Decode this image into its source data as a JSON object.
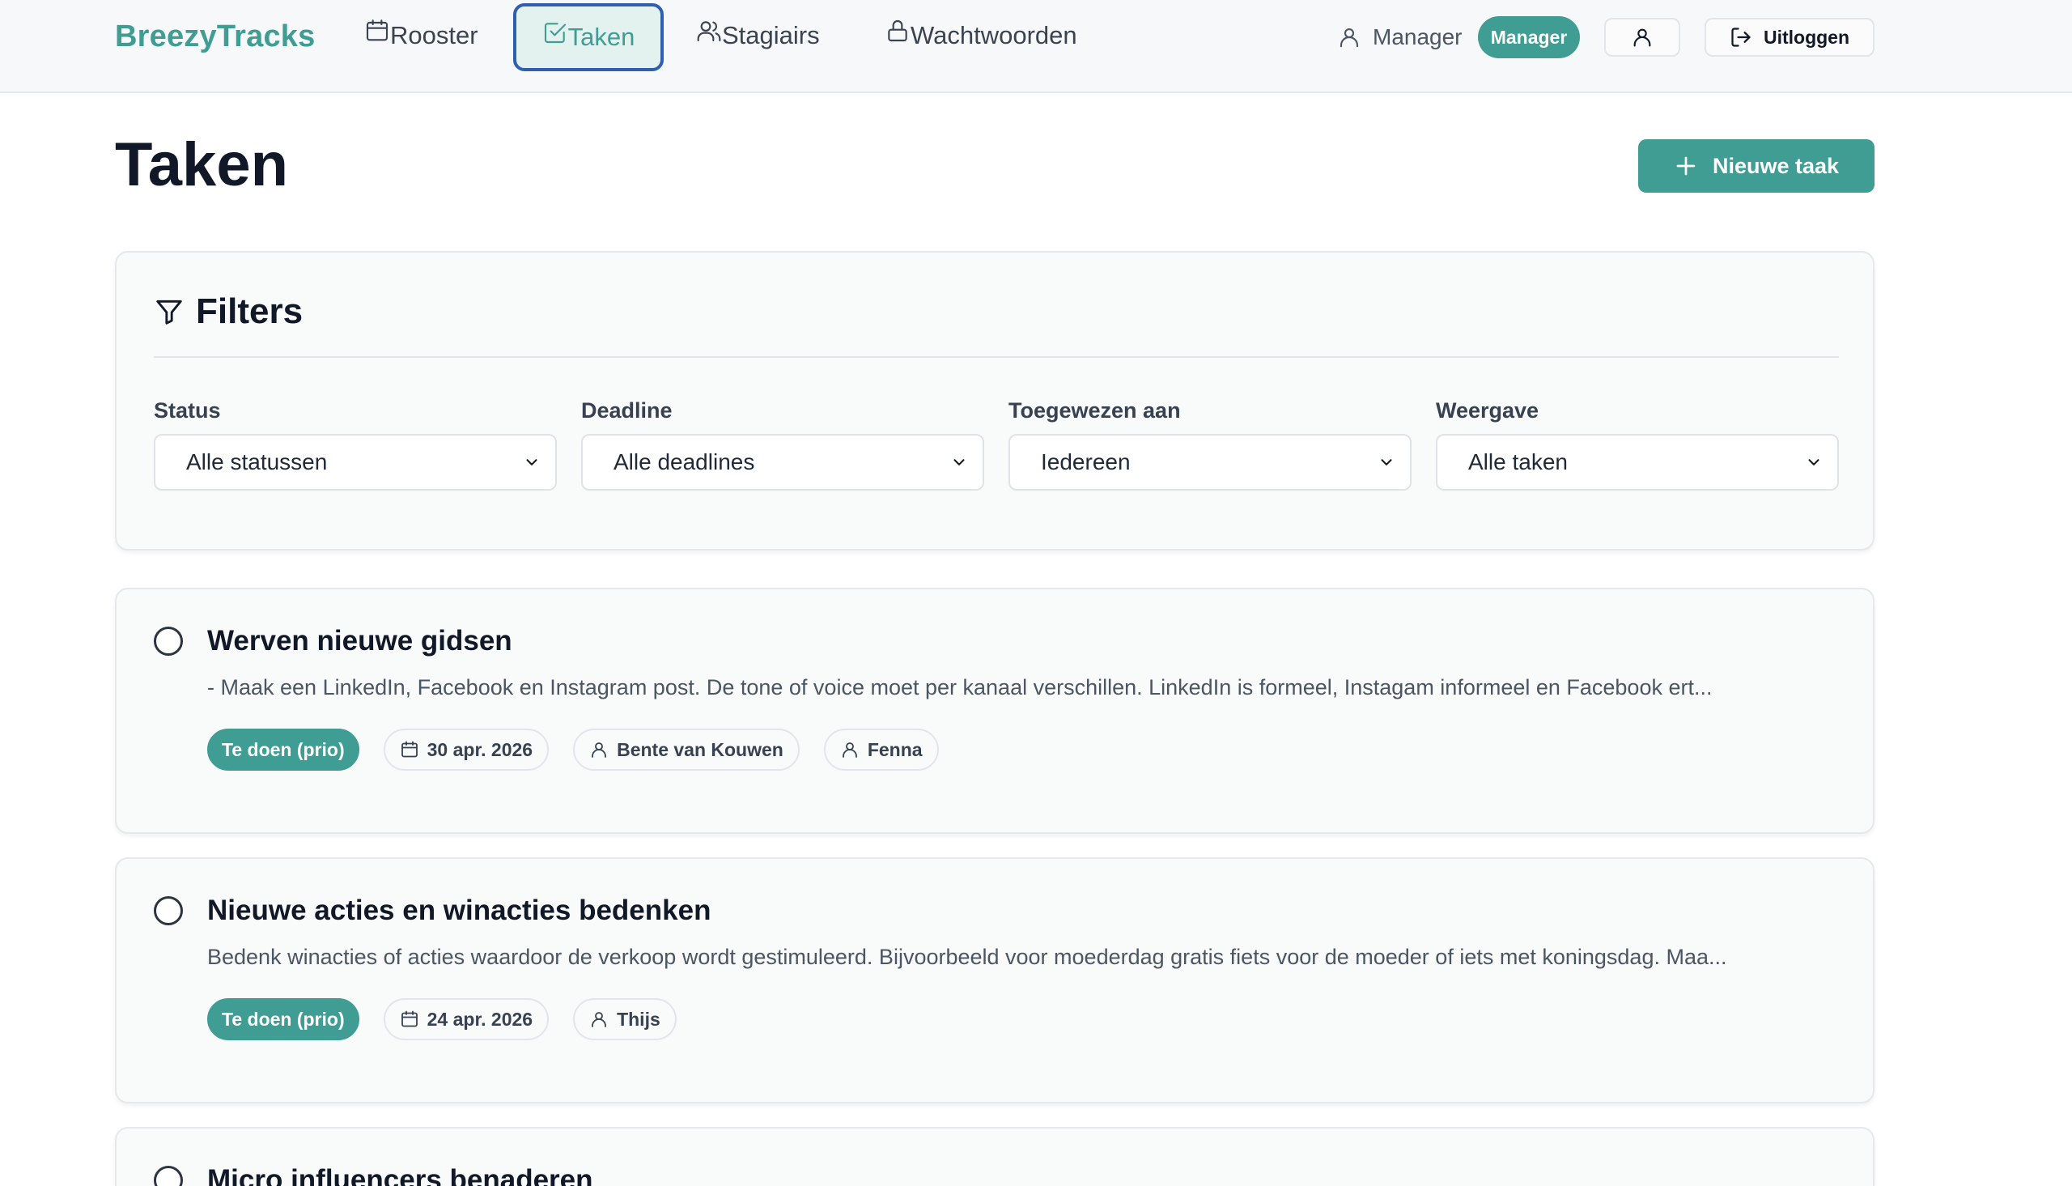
{
  "nav": {
    "brand": "BreezyTracks",
    "items": [
      {
        "label": "Rooster",
        "icon": "calendar-icon"
      },
      {
        "label": "Taken",
        "icon": "check-square-icon",
        "active": true
      },
      {
        "label": "Stagiairs",
        "icon": "users-icon"
      },
      {
        "label": "Wachtwoorden",
        "icon": "lock-icon"
      }
    ],
    "user_name": "Manager",
    "role_badge": "Manager",
    "logout_label": "Uitloggen"
  },
  "page": {
    "title": "Taken",
    "new_task_label": "Nieuwe taak"
  },
  "filters": {
    "title": "Filters",
    "groups": [
      {
        "label": "Status",
        "value": "Alle statussen"
      },
      {
        "label": "Deadline",
        "value": "Alle deadlines"
      },
      {
        "label": "Toegewezen aan",
        "value": "Iedereen"
      },
      {
        "label": "Weergave",
        "value": "Alle taken"
      }
    ]
  },
  "tasks": [
    {
      "title": "Werven nieuwe gidsen",
      "description": "- Maak een LinkedIn, Facebook en Instagram post. De tone of voice moet per kanaal verschillen. LinkedIn is formeel, Instagam informeel en Facebook ert...",
      "status": "Te doen (prio)",
      "deadline": "30 apr. 2026",
      "assignees": [
        "Bente van Kouwen",
        "Fenna"
      ]
    },
    {
      "title": "Nieuwe acties en winacties bedenken",
      "description": "Bedenk winacties of acties waardoor de verkoop wordt gestimuleerd. Bijvoorbeeld voor moederdag gratis fiets voor de moeder of iets met koningsdag. Maa...",
      "status": "Te doen (prio)",
      "deadline": "24 apr. 2026",
      "assignees": [
        "Thijs"
      ]
    },
    {
      "title": "Micro influencers benaderen",
      "description": "",
      "status": "",
      "deadline": "",
      "assignees": []
    }
  ],
  "colors": {
    "accent": "#3f9d94",
    "focus_ring": "#2f5fb0",
    "text_dark": "#111827"
  }
}
